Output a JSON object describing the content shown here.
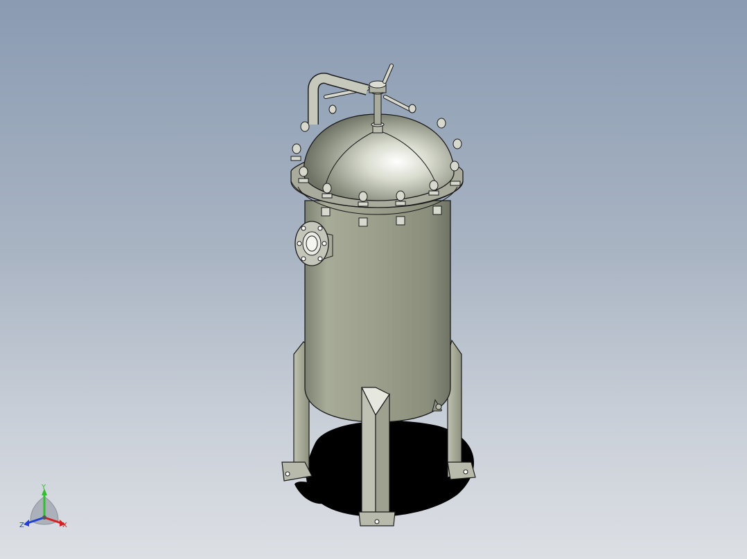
{
  "viewport": {
    "background_top": "#8a9bb2",
    "background_bottom": "#dcdfe4"
  },
  "model": {
    "description_icon": "pressure-vessel-model",
    "body_color": "#9ea28f",
    "edge_color": "#1a1a1a"
  },
  "triad": {
    "y_label": "Y",
    "x_label": "X",
    "z_label": "Z",
    "y_color": "#2fbf2f",
    "x_color": "#d42020",
    "z_color": "#2040d0"
  }
}
